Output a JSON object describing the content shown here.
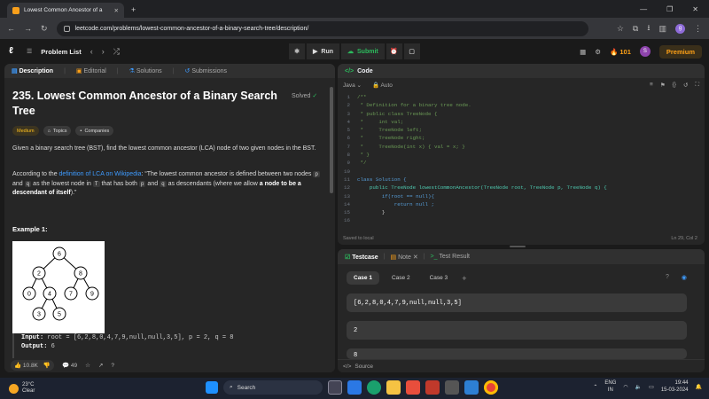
{
  "browser": {
    "tab_title": "Lowest Common Ancestor of a",
    "url": "leetcode.com/problems/lowest-common-ancestor-of-a-binary-search-tree/description/",
    "profile_initial": "g"
  },
  "nav": {
    "problem_list": "Problem List",
    "run": "Run",
    "submit": "Submit",
    "streak": "101",
    "avatar_initial": "S",
    "premium": "Premium"
  },
  "left": {
    "tabs": [
      "Description",
      "Editorial",
      "Solutions",
      "Submissions"
    ],
    "title": "235. Lowest Common Ancestor of a Binary Search Tree",
    "solved": "Solved",
    "tags": [
      "Medium",
      "Topics",
      "Companies"
    ],
    "desc1": "Given a binary search tree (BST), find the lowest common ancestor (LCA) node of two given nodes in the BST.",
    "desc2_a": "According to the ",
    "desc2_link": "definition of LCA on Wikipedia",
    "desc2_b": ": “The lowest common ancestor is defined between two nodes ",
    "desc2_p": "p",
    "desc2_c": " and ",
    "desc2_q": "q",
    "desc2_d": " as the lowest node in ",
    "desc2_T": "T",
    "desc2_e": " that has both ",
    "desc2_p2": "p",
    "desc2_f": " and ",
    "desc2_q2": "q",
    "desc2_g": " as descendants (where we allow ",
    "desc2_bold": "a node to be a descendant of itself",
    "desc2_h": ").”",
    "example_label": "Example 1:",
    "tree_nodes": [
      "6",
      "2",
      "8",
      "0",
      "4",
      "7",
      "9",
      "3",
      "5"
    ],
    "input_label": "Input:",
    "input_value": " root = [6,2,8,0,4,7,9,null,null,3,5], p = 2, q = 8",
    "output_label": "Output:",
    "output_value": " 6",
    "likes": "10.8K",
    "comments": "49"
  },
  "code": {
    "header": "Code",
    "language": "Java",
    "mode": "Auto",
    "lines": [
      {
        "n": "1",
        "t": "/**"
      },
      {
        "n": "2",
        "t": " * Definition for a binary tree node."
      },
      {
        "n": "3",
        "t": " * public class TreeNode {"
      },
      {
        "n": "4",
        "t": " *     int val;"
      },
      {
        "n": "5",
        "t": " *     TreeNode left;"
      },
      {
        "n": "6",
        "t": " *     TreeNode right;"
      },
      {
        "n": "7",
        "t": " *     TreeNode(int x) { val = x; }"
      },
      {
        "n": "8",
        "t": " * }"
      },
      {
        "n": "9",
        "t": " */"
      },
      {
        "n": "10",
        "t": ""
      },
      {
        "n": "11",
        "t": "class Solution {"
      },
      {
        "n": "12",
        "t": "    public TreeNode lowestCommonAncestor(TreeNode root, TreeNode p, TreeNode q) {"
      },
      {
        "n": "13",
        "t": "        if(root == null){"
      },
      {
        "n": "14",
        "t": "            return null ;"
      },
      {
        "n": "15",
        "t": "        }"
      },
      {
        "n": "16",
        "t": ""
      }
    ],
    "saved": "Saved to local",
    "cursor": "Ln 29, Col 2"
  },
  "testcase": {
    "tabs": [
      "Testcase",
      "Note",
      "Test Result"
    ],
    "cases": [
      "Case 1",
      "Case 2",
      "Case 3"
    ],
    "input1": "[6,2,8,0,4,7,9,null,null,3,5]",
    "input2": "2",
    "input3": "8",
    "source": "Source"
  },
  "taskbar": {
    "temp": "23°C",
    "weather": "Clear",
    "search": "Search",
    "lang1": "ENG",
    "lang2": "IN",
    "time": "19:44",
    "date": "15-03-2024"
  }
}
